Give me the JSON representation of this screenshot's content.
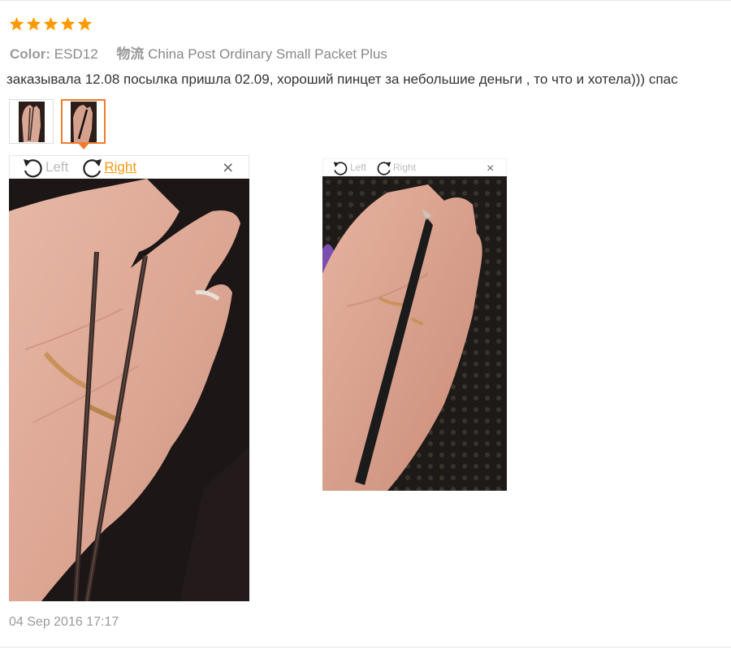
{
  "review": {
    "rating": 5,
    "star_color": "#ff9900",
    "color_label": "Color:",
    "color_value": "ESD12",
    "shipping_label": "物流",
    "shipping_value": "China Post Ordinary Small Packet Plus",
    "text": "заказывала 12.08 посылка пришла 02.09, хороший пинцет за небольшие деньги , то что и хотела))) спас",
    "date": "04 Sep 2016 17:17"
  },
  "thumbnails": [
    {
      "name": "photo-1",
      "active": false
    },
    {
      "name": "photo-2",
      "active": true
    }
  ],
  "viewer_large": {
    "rotate_left": "Left",
    "rotate_right": "Right",
    "close": "×"
  },
  "viewer_small": {
    "rotate_left": "Left",
    "rotate_right": "Right",
    "close": "×"
  },
  "colors": {
    "accent": "#f07c2a",
    "link_active": "#f39c12"
  }
}
